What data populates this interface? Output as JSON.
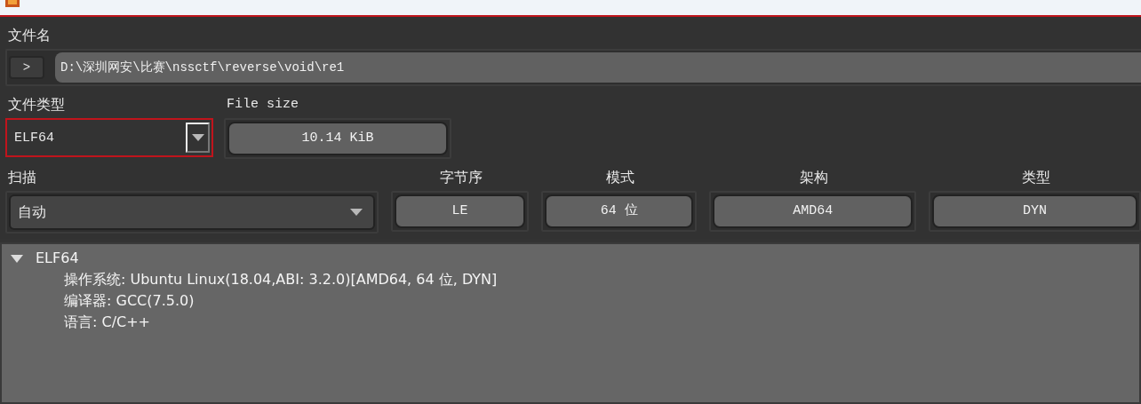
{
  "file_name": {
    "label": "文件名",
    "button": ">",
    "path": "D:\\深圳网安\\比赛\\nssctf\\reverse\\void\\re1"
  },
  "file_type": {
    "label": "文件类型",
    "value": "ELF64",
    "focused": true
  },
  "file_size": {
    "label": "File size",
    "value": "10.14 KiB"
  },
  "scan": {
    "label": "扫描",
    "value": "自动"
  },
  "info": [
    {
      "label": "字节序",
      "value": "LE"
    },
    {
      "label": "模式",
      "value": "64 位"
    },
    {
      "label": "架构",
      "value": "AMD64"
    },
    {
      "label": "类型",
      "value": "DYN"
    }
  ],
  "results": [
    {
      "label": "ELF64",
      "expanded": true,
      "children": [
        {
          "label": "操作系统: Ubuntu Linux(18.04,ABI: 3.2.0)[AMD64, 64 位, DYN]"
        },
        {
          "label": "编译器: GCC(7.5.0)"
        },
        {
          "label": "语言: C/C++"
        }
      ]
    }
  ]
}
